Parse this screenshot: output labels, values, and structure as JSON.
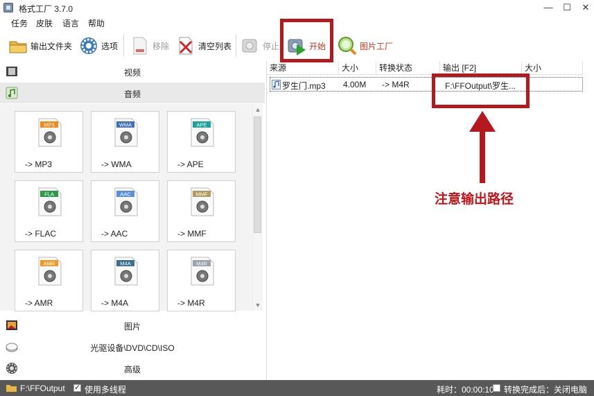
{
  "window": {
    "title": "格式工厂 3.7.0",
    "min": "—",
    "max": "☐",
    "close": "✕"
  },
  "menu": [
    "任务",
    "皮肤",
    "语言",
    "帮助"
  ],
  "toolbar": {
    "output_folder": "输出文件夹",
    "options": "选项",
    "remove": "移除",
    "clear_list": "清空列表",
    "stop": "停止",
    "start": "开始",
    "picture_factory": "图片工厂"
  },
  "categories": {
    "video": "视频",
    "audio": "音频",
    "picture": "图片",
    "rom": "光驱设备\\DVD\\CD\\ISO",
    "advanced": "高级"
  },
  "formats": [
    {
      "badge": "MP3",
      "label": "-> MP3",
      "color": "#f08a1e"
    },
    {
      "badge": "WMA",
      "label": "-> WMA",
      "color": "#3f6fb5"
    },
    {
      "badge": "APE",
      "label": "-> APE",
      "color": "#1aa39a"
    },
    {
      "badge": "FLA",
      "label": "-> FLAC",
      "color": "#2f9a4a"
    },
    {
      "badge": "AAC",
      "label": "-> AAC",
      "color": "#5b8fd6"
    },
    {
      "badge": "MMF",
      "label": "-> MMF",
      "color": "#b39a5e"
    },
    {
      "badge": "AMR",
      "label": "-> AMR",
      "color": "#f09a2a"
    },
    {
      "badge": "M4A",
      "label": "-> M4A",
      "color": "#3d6f8e"
    },
    {
      "badge": "M4R",
      "label": "-> M4R",
      "color": "#9aa3ab"
    }
  ],
  "columns": [
    "来源",
    "大小",
    "转换状态",
    "输出 [F2]",
    "大小"
  ],
  "files": [
    {
      "source": "罗生门.mp3",
      "size": "4.00M",
      "status": "-> M4R",
      "output": "F:\\FFOutput\\罗生...",
      "out_size": ""
    }
  ],
  "annotation": {
    "note": "注意输出路径",
    "color": "#b5181d"
  },
  "status": {
    "path": "F:\\FFOutput",
    "multithread": "使用多线程",
    "elapsed": "耗时：00:00:10",
    "after": "转换完成后：关闭电脑"
  }
}
